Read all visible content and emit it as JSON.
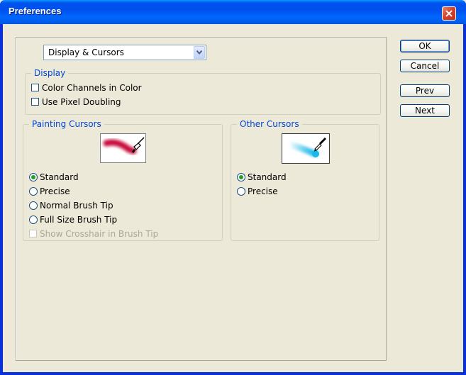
{
  "window": {
    "title": "Preferences"
  },
  "dropdown": {
    "selected": "Display & Cursors"
  },
  "display_group": {
    "label": "Display",
    "items": [
      {
        "label": "Color Channels in Color",
        "checked": false
      },
      {
        "label": "Use Pixel Doubling",
        "checked": false
      }
    ]
  },
  "painting_cursors": {
    "label": "Painting Cursors",
    "preview_icon": "brush-stroke-with-brush-icon",
    "options": [
      {
        "label": "Standard",
        "selected": true
      },
      {
        "label": "Precise",
        "selected": false
      },
      {
        "label": "Normal Brush Tip",
        "selected": false
      },
      {
        "label": "Full Size Brush Tip",
        "selected": false
      }
    ],
    "crosshair": {
      "label": "Show Crosshair in Brush Tip",
      "checked": false,
      "enabled": false
    }
  },
  "other_cursors": {
    "label": "Other Cursors",
    "preview_icon": "eyedropper-stroke-icon",
    "options": [
      {
        "label": "Standard",
        "selected": true
      },
      {
        "label": "Precise",
        "selected": false
      }
    ]
  },
  "buttons": {
    "ok": "OK",
    "cancel": "Cancel",
    "prev": "Prev",
    "next": "Next"
  },
  "colors": {
    "group_label": "#0046d5",
    "title_bar": "#0058e0",
    "painting_stroke": "#c8103c",
    "other_stroke": "#1ab8e8"
  }
}
